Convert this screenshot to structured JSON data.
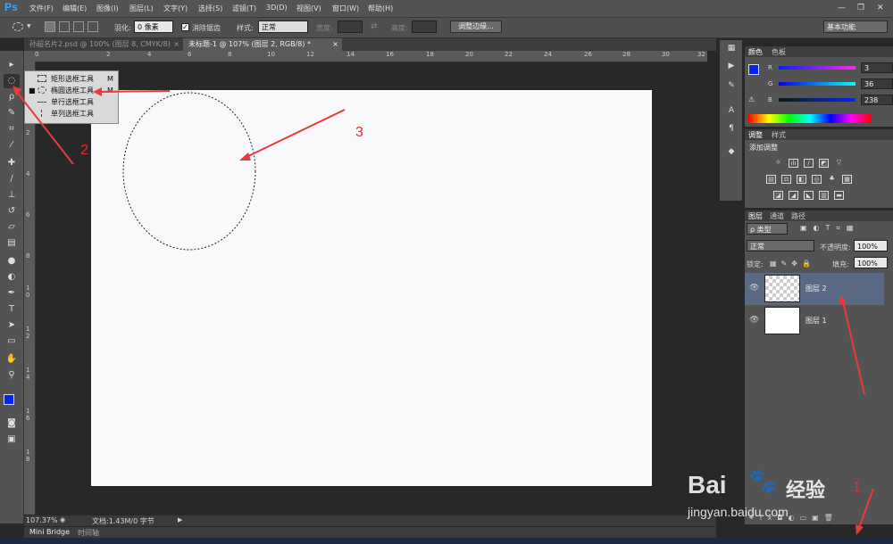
{
  "app": {
    "logo": "Ps"
  },
  "menu": [
    "文件(F)",
    "编辑(E)",
    "图像(I)",
    "图层(L)",
    "文字(Y)",
    "选择(S)",
    "滤镜(T)",
    "3D(D)",
    "视图(V)",
    "窗口(W)",
    "帮助(H)"
  ],
  "window_controls": {
    "minimize": "—",
    "restore": "❐",
    "close": "✕"
  },
  "options": {
    "feather_label": "羽化:",
    "feather_value": "0 像素",
    "antialias_label": "消除锯齿",
    "style_label": "样式:",
    "style_value": "正常",
    "width_label": "宽度:",
    "height_label": "高度:",
    "refine_button": "调整边缘...",
    "workspace": "基本功能"
  },
  "tabs": [
    {
      "label": "孙超名片2.psd @ 100% (图层 8, CMYK/8)",
      "close": "×"
    },
    {
      "label": "未标题-1 @ 107% (图层 2, RGB/8) *",
      "close": "×"
    }
  ],
  "ruler_top": [
    "0",
    "2",
    "4",
    "6",
    "8",
    "10",
    "12",
    "14",
    "16",
    "18",
    "20",
    "22",
    "24",
    "26",
    "28",
    "30",
    "32"
  ],
  "ruler_left": [
    "0",
    "2",
    "4",
    "6",
    "8",
    "1",
    "0",
    "1",
    "2",
    "1",
    "4",
    "1",
    "6",
    "1",
    "8"
  ],
  "flyout": [
    {
      "label": "矩形选框工具",
      "key": "M",
      "selected": false
    },
    {
      "label": "椭圆选框工具",
      "key": "M",
      "selected": true
    },
    {
      "label": "单行选框工具",
      "key": "",
      "selected": false
    },
    {
      "label": "单列选框工具",
      "key": "",
      "selected": false
    }
  ],
  "status": {
    "zoom": "107.37%",
    "doc": "文档:1.43M/0 字节"
  },
  "bottom_tabs": [
    "Mini Bridge",
    "时间轴"
  ],
  "color_panel": {
    "tabs": [
      "颜色",
      "色板"
    ],
    "r_label": "R",
    "r": "3",
    "g_label": "G",
    "g": "36",
    "b_label": "B",
    "b": "238",
    "fg_color": "#0324ee"
  },
  "adjust_panel": {
    "tabs": [
      "调整",
      "样式"
    ],
    "title": "添加调整"
  },
  "layers_panel": {
    "tabs": [
      "图层",
      "通道",
      "路径"
    ],
    "filter_label": "ρ 类型",
    "blend": "正常",
    "opacity_label": "不透明度:",
    "opacity": "100%",
    "lock_label": "锁定:",
    "fill_label": "填充:",
    "fill": "100%",
    "layers": [
      {
        "name": "图层 2",
        "selected": true
      },
      {
        "name": "图层 1",
        "selected": false
      }
    ]
  },
  "annotations": [
    "1",
    "2",
    "3"
  ],
  "watermark": {
    "brand": "Bai",
    "brand_cn": "经验",
    "url": "jingyan.baidu.com"
  },
  "colors": {
    "accent": "#3ea6f5",
    "arrow": "#e83a3a",
    "selected_layer": "#5a6a84"
  }
}
